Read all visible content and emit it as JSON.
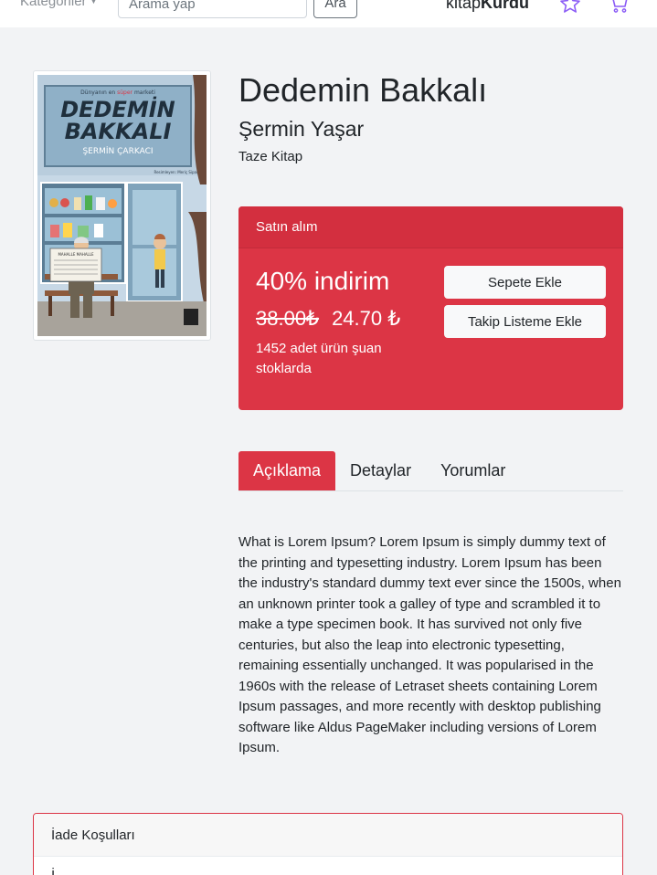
{
  "navbar": {
    "categories_label": "Kategoriler",
    "search_placeholder": "Arama yap",
    "search_button": "Ara",
    "brand_prefix": "kitap",
    "brand_suffix": "Kurdu",
    "icons": [
      "star-icon",
      "cart-icon"
    ],
    "accent_color": "#8b5cf6"
  },
  "cover": {
    "tagline_pre": "Dünyanın en",
    "tagline_em": "süper",
    "tagline_post": "marketi",
    "title_line1": "DEDEMİN",
    "title_line2": "BAKKALI",
    "author": "ŞERMİN ÇARKACI",
    "illustrator": "Resimleyen: Meriç Sipan",
    "newspaper_text": "MAHALLE MAHALLE"
  },
  "book": {
    "title": "Dedemin Bakkalı",
    "author": "Şermin Yaşar",
    "publisher": "Taze Kitap"
  },
  "purchase": {
    "header": "Satın alım",
    "discount": "40% indirim",
    "old_price": "38.00₺",
    "price": "24.70 ₺",
    "stock": "1452 adet ürün şuan stoklarda",
    "add_to_cart": "Sepete Ekle",
    "add_to_watchlist": "Takip Listeme Ekle",
    "color": "#dc3545"
  },
  "tabs": [
    {
      "label": "Açıklama",
      "active": true
    },
    {
      "label": "Detaylar",
      "active": false
    },
    {
      "label": "Yorumlar",
      "active": false
    }
  ],
  "description": "What is Lorem Ipsum? Lorem Ipsum is simply dummy text of the printing and typesetting industry. Lorem Ipsum has been the industry's standard dummy text ever since the 1500s, when an unknown printer took a galley of type and scrambled it to make a type specimen book. It has survived not only five centuries, but also the leap into electronic typesetting, remaining essentially unchanged. It was popularised in the 1960s with the release of Letraset sheets containing Lorem Ipsum passages, and more recently with desktop publishing software like Aldus PageMaker including versions of Lorem Ipsum.",
  "return_policy": {
    "header": "İade Koşulları",
    "body": "İ"
  }
}
